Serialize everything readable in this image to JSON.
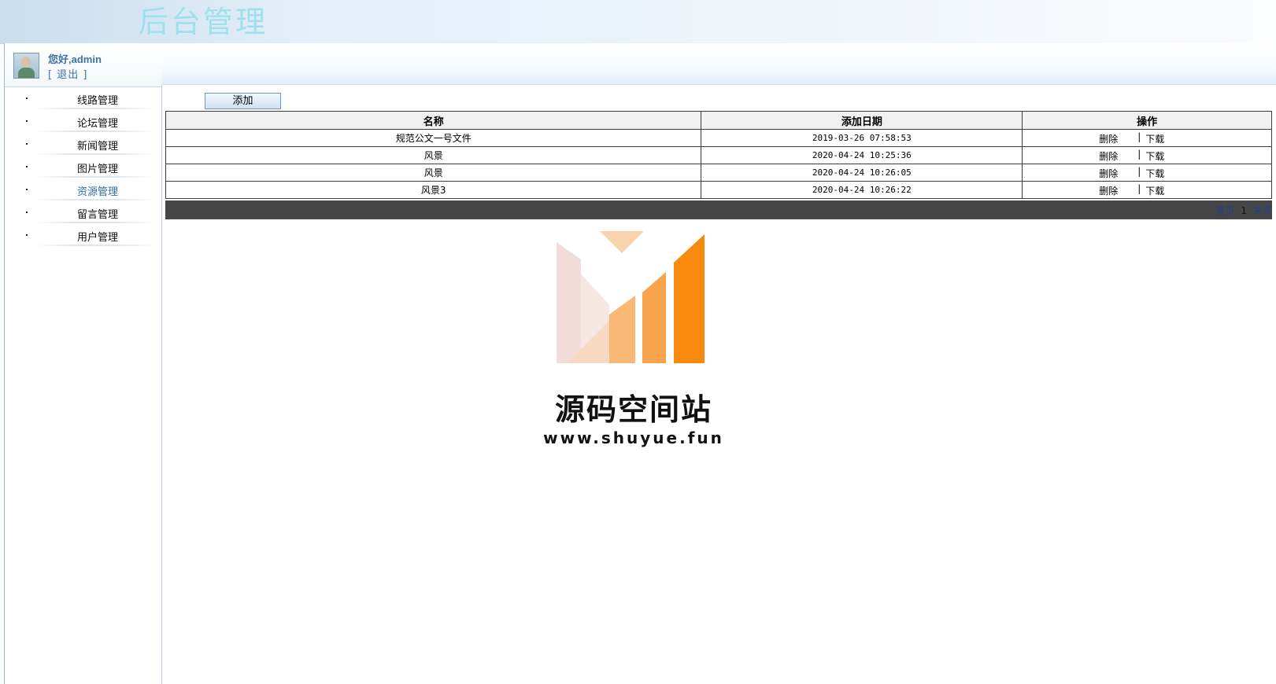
{
  "header": {
    "title": "后台管理"
  },
  "user": {
    "greeting": "您好,admin",
    "logout": "[   退出   ]"
  },
  "sidebar": {
    "items": [
      {
        "label": "线路管理",
        "active": false
      },
      {
        "label": "论坛管理",
        "active": false
      },
      {
        "label": "新闻管理",
        "active": false
      },
      {
        "label": "图片管理",
        "active": false
      },
      {
        "label": "资源管理",
        "active": true
      },
      {
        "label": "留言管理",
        "active": false
      },
      {
        "label": "用户管理",
        "active": false
      }
    ]
  },
  "toolbar": {
    "add_label": "添加"
  },
  "table": {
    "headers": [
      "名称",
      "添加日期",
      "操作"
    ],
    "rows": [
      {
        "name": "规范公文一号文件",
        "date": "2019-03-26 07:58:53",
        "delete": "删除",
        "separator": "|",
        "download": "下载"
      },
      {
        "name": "风景",
        "date": "2020-04-24 10:25:36",
        "delete": "删除",
        "separator": "|",
        "download": "下载"
      },
      {
        "name": "风景",
        "date": "2020-04-24 10:26:05",
        "delete": "删除",
        "separator": "|",
        "download": "下载"
      },
      {
        "name": "风景3",
        "date": "2020-04-24 10:26:22",
        "delete": "删除",
        "separator": "|",
        "download": "下载"
      }
    ]
  },
  "pagination": {
    "first": "首页",
    "current": "1",
    "last": "末页"
  },
  "watermark": {
    "name": "源码空间站",
    "url": "www.shuyue.fun"
  },
  "colors": {
    "link": "#3d72a3",
    "pager_bar": "#464646",
    "brand_orange": "#f7890f"
  }
}
